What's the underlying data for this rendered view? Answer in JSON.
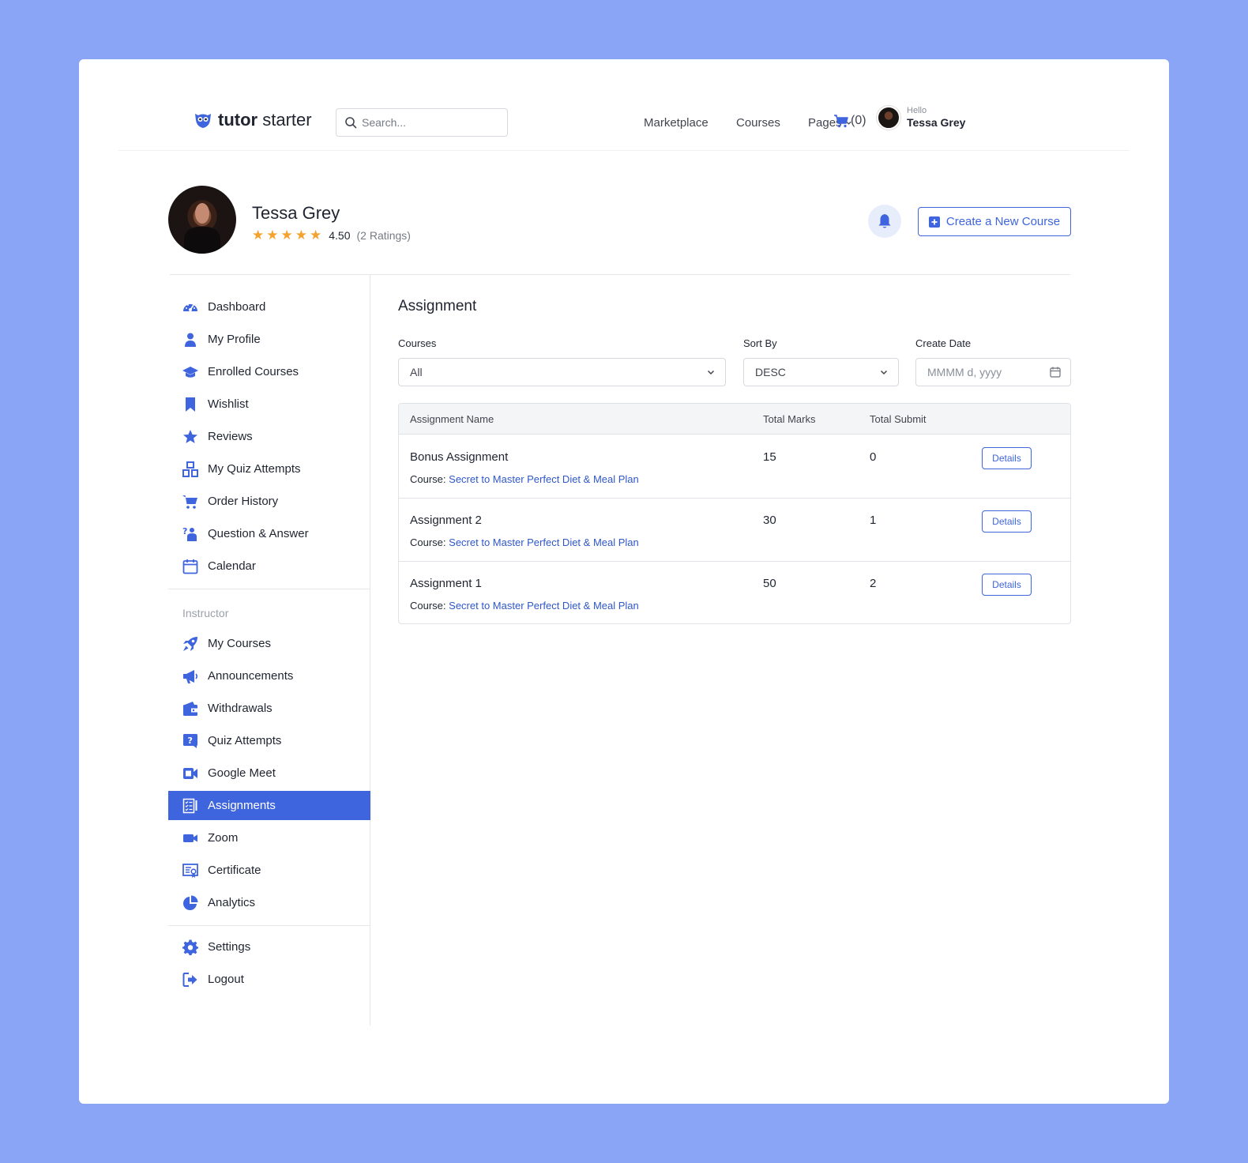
{
  "header": {
    "logo_bold": "tutor",
    "logo_light": "starter",
    "search_placeholder": "Search...",
    "nav": [
      "Marketplace",
      "Courses",
      "Pages"
    ],
    "cart_count": "(0)",
    "hello": "Hello",
    "user_name": "Tessa Grey"
  },
  "profile": {
    "name": "Tessa Grey",
    "rating_value": "4.50",
    "rating_count": "(2 Ratings)",
    "stars": 5,
    "create_label": "Create a New Course"
  },
  "sidebar": {
    "items": [
      {
        "label": "Dashboard",
        "icon": "dashboard-icon"
      },
      {
        "label": "My Profile",
        "icon": "user-icon"
      },
      {
        "label": "Enrolled Courses",
        "icon": "graduation-cap-icon"
      },
      {
        "label": "Wishlist",
        "icon": "bookmark-icon"
      },
      {
        "label": "Reviews",
        "icon": "star-icon"
      },
      {
        "label": "My Quiz Attempts",
        "icon": "quiz-attempts-icon"
      },
      {
        "label": "Order History",
        "icon": "cart-icon"
      },
      {
        "label": "Question & Answer",
        "icon": "question-answer-icon"
      },
      {
        "label": "Calendar",
        "icon": "calendar-icon"
      }
    ],
    "instructor_heading": "Instructor",
    "instructor_items": [
      {
        "label": "My Courses",
        "icon": "rocket-icon"
      },
      {
        "label": "Announcements",
        "icon": "megaphone-icon"
      },
      {
        "label": "Withdrawals",
        "icon": "wallet-icon"
      },
      {
        "label": "Quiz Attempts",
        "icon": "quiz-icon"
      },
      {
        "label": "Google Meet",
        "icon": "google-meet-icon"
      },
      {
        "label": "Assignments",
        "icon": "assignments-icon"
      },
      {
        "label": "Zoom",
        "icon": "video-icon"
      },
      {
        "label": "Certificate",
        "icon": "certificate-icon"
      },
      {
        "label": "Analytics",
        "icon": "pie-chart-icon"
      }
    ],
    "bottom_items": [
      {
        "label": "Settings",
        "icon": "gear-icon"
      },
      {
        "label": "Logout",
        "icon": "logout-icon"
      }
    ],
    "active": "Assignments"
  },
  "main": {
    "title": "Assignment",
    "filters": {
      "courses_label": "Courses",
      "courses_value": "All",
      "sort_label": "Sort By",
      "sort_value": "DESC",
      "date_label": "Create Date",
      "date_placeholder": "MMMM d, yyyy"
    },
    "table": {
      "headers": [
        "Assignment Name",
        "Total Marks",
        "Total Submit"
      ],
      "course_prefix": "Course:",
      "details_label": "Details",
      "rows": [
        {
          "name": "Bonus Assignment",
          "course": "Secret to Master Perfect Diet & Meal Plan",
          "marks": "15",
          "submit": "0"
        },
        {
          "name": "Assignment 2",
          "course": "Secret to Master Perfect Diet & Meal Plan",
          "marks": "30",
          "submit": "1"
        },
        {
          "name": "Assignment 1",
          "course": "Secret to Master Perfect Diet & Meal Plan",
          "marks": "50",
          "submit": "2"
        }
      ]
    }
  },
  "colors": {
    "background": "#8aa5f5",
    "accent": "#3e64de",
    "star": "#f4a22e",
    "link": "#2f57c9"
  }
}
